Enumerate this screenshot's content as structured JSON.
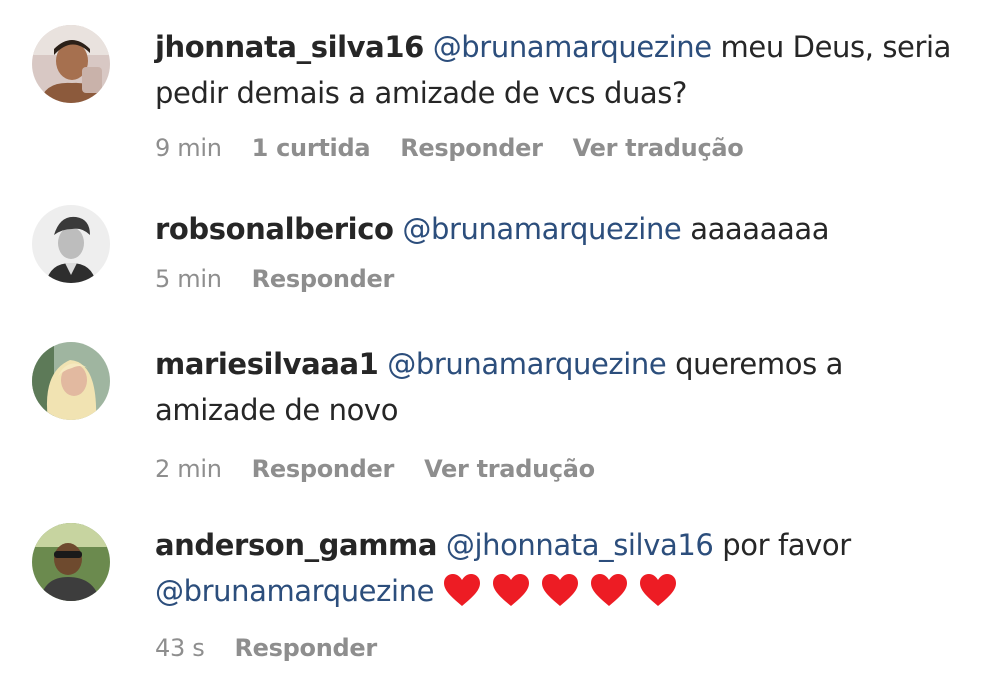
{
  "comments": [
    {
      "username": "jhonnata_silva16",
      "parts": [
        {
          "type": "mention",
          "text": "@brunamarquezine"
        },
        {
          "type": "text",
          "text": " meu Deus, seria"
        },
        {
          "type": "text",
          "text": "pedir demais a amizade de vcs duas?"
        }
      ],
      "time": "9 min",
      "likes": "1 curtida",
      "reply": "Responder",
      "translate": "Ver tradução"
    },
    {
      "username": "robsonalberico",
      "parts": [
        {
          "type": "mention",
          "text": "@brunamarquezine"
        },
        {
          "type": "text",
          "text": " aaaaaaaa"
        }
      ],
      "time": "5 min",
      "reply": "Responder"
    },
    {
      "username": "mariesilvaaa1",
      "parts": [
        {
          "type": "mention",
          "text": "@brunamarquezine"
        },
        {
          "type": "text",
          "text": " queremos a"
        },
        {
          "type": "text",
          "text": "amizade de novo"
        }
      ],
      "time": "2 min",
      "reply": "Responder",
      "translate": "Ver tradução"
    },
    {
      "username": "anderson_gamma",
      "parts": [
        {
          "type": "mention",
          "text": "@jhonnata_silva16"
        },
        {
          "type": "text",
          "text": " por favor"
        },
        {
          "type": "mention",
          "text": "@brunamarquezine"
        }
      ],
      "hearts": [
        "heart-icon",
        "heart-icon",
        "heart-icon",
        "heart-icon",
        "heart-icon"
      ],
      "time": "43 s",
      "reply": "Responder"
    }
  ],
  "colors": {
    "text": "#262626",
    "mention": "#2c4e7c",
    "meta": "#8e8e8e",
    "heart": "#ed1c24"
  }
}
